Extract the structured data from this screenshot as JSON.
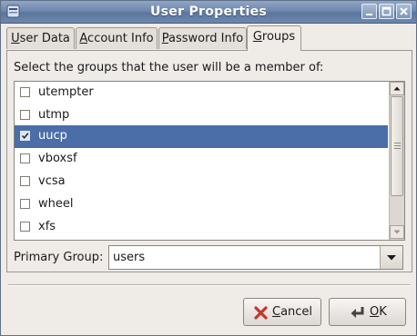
{
  "window": {
    "title": "User Properties"
  },
  "tabs": [
    {
      "label": "User Data",
      "mnemonic": "U",
      "rest": "ser Data"
    },
    {
      "label": "Account Info",
      "mnemonic": "A",
      "rest": "ccount Info"
    },
    {
      "label": "Password Info",
      "mnemonic": "P",
      "rest": "assword Info"
    },
    {
      "label": "Groups",
      "mnemonic": "G",
      "rest": "roups",
      "active": true
    }
  ],
  "groups_panel": {
    "instruction": "Select the groups that the user will be a member of:",
    "groups": [
      {
        "name": "utempter",
        "checked": false,
        "selected": false
      },
      {
        "name": "utmp",
        "checked": false,
        "selected": false
      },
      {
        "name": "uucp",
        "checked": true,
        "selected": true
      },
      {
        "name": "vboxsf",
        "checked": false,
        "selected": false
      },
      {
        "name": "vcsa",
        "checked": false,
        "selected": false
      },
      {
        "name": "wheel",
        "checked": false,
        "selected": false
      },
      {
        "name": "xfs",
        "checked": false,
        "selected": false
      }
    ],
    "primary_group_label": "Primary Group:",
    "primary_group_value": "users"
  },
  "buttons": {
    "cancel": {
      "label": "Cancel",
      "mnemonic": "C",
      "rest": "ancel",
      "icon": "cancel-x-icon"
    },
    "ok": {
      "label": "OK",
      "mnemonic": "O",
      "rest": "K",
      "icon": "ok-enter-arrow-icon"
    }
  },
  "colors": {
    "titlebar": "#6f88ad",
    "selection": "#4b6ea9",
    "window_bg": "#efebe7"
  }
}
